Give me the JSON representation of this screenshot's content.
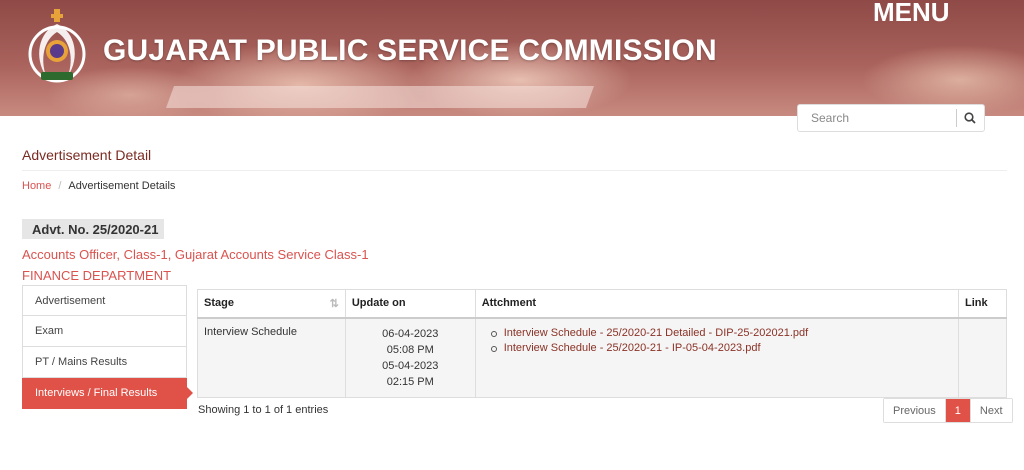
{
  "header": {
    "title": "GUJARAT PUBLIC SERVICE COMMISSION",
    "menu_label": "MENU",
    "logo_icon": "gpsc-emblem-icon"
  },
  "search": {
    "placeholder": "Search",
    "icon": "search-icon"
  },
  "page": {
    "title": "Advertisement Detail"
  },
  "breadcrumb": {
    "home": "Home",
    "separator": "/",
    "current": "Advertisement Details"
  },
  "advertisement": {
    "number": "Advt. No. 25/2020-21",
    "post": "Accounts Officer, Class-1, Gujarat Accounts Service Class-1",
    "department": "FINANCE DEPARTMENT"
  },
  "tabs": [
    {
      "label": "Advertisement",
      "active": false
    },
    {
      "label": "Exam",
      "active": false
    },
    {
      "label": "PT / Mains Results",
      "active": false
    },
    {
      "label": "Interviews / Final Results",
      "active": true
    }
  ],
  "table": {
    "headers": {
      "stage": "Stage",
      "update_on": "Update on",
      "attachment": "Attchment",
      "link": "Link"
    },
    "rows": [
      {
        "stage": "Interview Schedule",
        "update_date_1": "06-04-2023",
        "update_time_1": "05:08 PM",
        "update_date_2": "05-04-2023",
        "update_time_2": "02:15 PM",
        "attachments": [
          "Interview Schedule - 25/2020-21 Detailed - DIP-25-202021.pdf",
          "Interview Schedule - 25/2020-21 - IP-05-04-2023.pdf"
        ],
        "link": ""
      }
    ]
  },
  "pagination": {
    "info": "Showing 1 to 1 of 1 entries",
    "previous": "Previous",
    "current_page": "1",
    "next": "Next"
  },
  "colors": {
    "accent": "#e05248",
    "title_brown": "#7a2b22",
    "link_red": "#d9534f"
  }
}
